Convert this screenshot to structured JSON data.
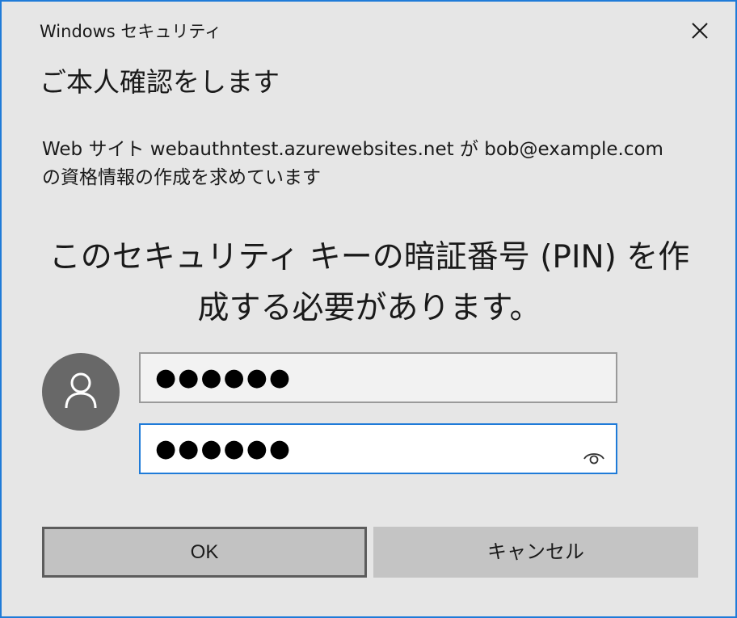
{
  "window": {
    "title": "Windows セキュリティ",
    "close_icon": "close-icon"
  },
  "heading": "ご本人確認をします",
  "message": {
    "line1": "Web サイト webauthntest.azurewebsites.net が bob@example.com",
    "line2": "の資格情報の作成を求めています"
  },
  "prompt": {
    "line1": "このセキュリティ キーの暗証番号 (PIN) を作",
    "line2": "成する必要があります。"
  },
  "avatar": {
    "icon": "user-icon",
    "color": "#686868"
  },
  "pin": {
    "value": "●●●●●●",
    "confirm_value": "●●●●●●",
    "reveal_icon": "eye-icon"
  },
  "buttons": {
    "ok": "OK",
    "cancel": "キャンセル"
  },
  "colors": {
    "accent": "#1f7bd8",
    "background": "#e6e6e6"
  }
}
